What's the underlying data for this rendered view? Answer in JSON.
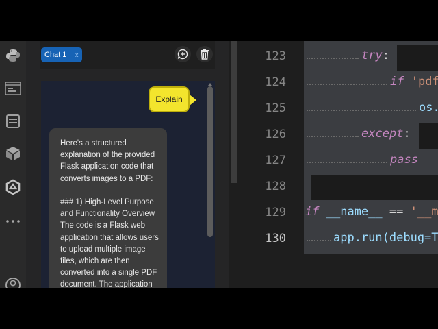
{
  "chat": {
    "tab_label": "Chat 1",
    "tab_close": "x",
    "user_message": "Explain",
    "assistant_message": "Here's a structured explanation of the provided Flask application code that converts images to a PDF:\n\n### 1) High-Level Purpose and Functionality Overview\nThe code is a Flask web application that allows users to upload multiple image files, which are then converted into a single PDF document. The application"
  },
  "icons": {
    "activity": [
      "python-icon",
      "terminal-icon",
      "window-icon",
      "package-icon",
      "settings-hex-icon",
      "more-icon",
      "account-icon"
    ],
    "toolbar": [
      "new-chat-icon",
      "trash-icon"
    ]
  },
  "editor": {
    "line_numbers": [
      "123",
      "124",
      "125",
      "126",
      "127",
      "128",
      "129",
      "130"
    ],
    "active_line": "130",
    "lines": {
      "l123": {
        "kw": "try",
        "pun": ":"
      },
      "l124": {
        "kw": "if",
        "str": "'pdf"
      },
      "l125": {
        "id": "os."
      },
      "l126": {
        "kw": "except",
        "pun": ":"
      },
      "l127": {
        "kw": "pass"
      },
      "l129": {
        "kw": "if",
        "id": "__name__",
        "op": "==",
        "str": "'__m"
      },
      "l130": {
        "fn": "app.run(debug=T"
      }
    }
  },
  "colors": {
    "accent_tab": "#1763b5",
    "user_bubble": "#f3e52d",
    "keyword": "#c586c0",
    "string": "#ce9178",
    "identifier": "#9cdcfe"
  }
}
